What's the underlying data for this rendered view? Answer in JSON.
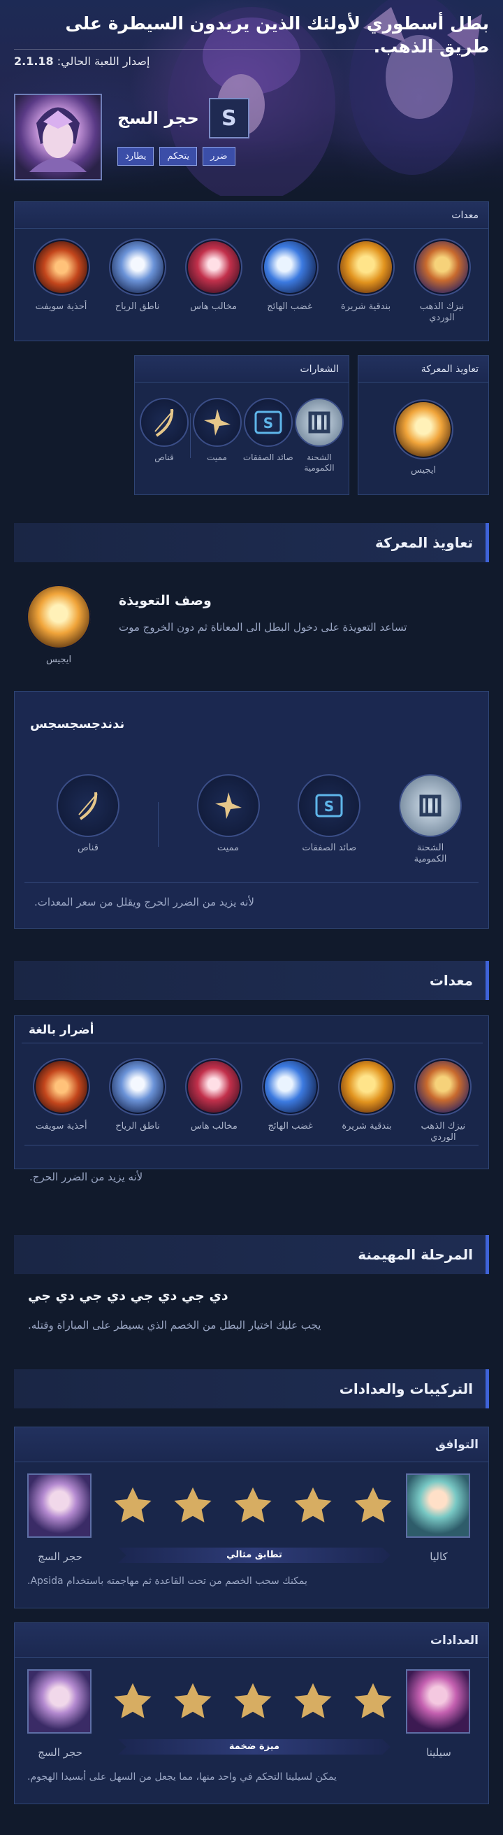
{
  "hero": {
    "title": "بطل أسطوري لأولئك الذين يريدون السيطرة على طريق الذهب.",
    "version_label": "إصدار اللعبة الحالي:",
    "version_value": "2.1.18",
    "class_icon": "S",
    "hero_name": "حجر السج",
    "tags": [
      "يطارد",
      "يتحكم",
      "ضرر"
    ]
  },
  "equipment_panel": {
    "title": "معدات",
    "items": [
      {
        "label": "نيزك الذهب الوردي",
        "icon": "pink-gold-meteor-icon"
      },
      {
        "label": "بندقية شريرة",
        "icon": "sinister-gun-icon"
      },
      {
        "label": "غضب الهائج",
        "icon": "berserker-rage-icon"
      },
      {
        "label": "مخالب هاس",
        "icon": "haas-claws-icon"
      },
      {
        "label": "ناطق الرياح",
        "icon": "windtalker-icon"
      },
      {
        "label": "أحذية سويفت",
        "icon": "swift-boots-icon"
      }
    ]
  },
  "emblems_panel": {
    "title": "الشعارات",
    "items": [
      {
        "label": "الشحنة الكمومية",
        "icon": "quantum-charge-icon"
      },
      {
        "label": "صائد الصفقات",
        "icon": "bargain-hunter-icon"
      },
      {
        "label": "مميت",
        "icon": "lethal-icon"
      },
      {
        "label": "قناص",
        "icon": "marksman-icon"
      }
    ]
  },
  "battle_spell_panel": {
    "title": "تعاويذ المعركة",
    "spell_label": "ايجيس"
  },
  "battle_spells_section": {
    "heading": "تعاويذ المعركة",
    "spell_name": "ايجيس",
    "desc_title": "وصف التعويذة",
    "desc_text": "تساعد التعويذة على دخول البطل الى المعاناة ثم دون الخروج موت"
  },
  "emblem_detail": {
    "title": "ندندجسجسجس",
    "items": [
      {
        "label": "الشحنة الكمومية"
      },
      {
        "label": "صائد الصفقات"
      },
      {
        "label": "مميت"
      },
      {
        "label": "قناص"
      }
    ],
    "note": "لأنه يزيد من الضرر الحرج ويقلل من سعر المعدات."
  },
  "equipment_section": {
    "heading": "معدات",
    "subtitle": "أضرار بالغة",
    "items": [
      {
        "label": "نيزك الذهب الوردي"
      },
      {
        "label": "بندقية شريرة"
      },
      {
        "label": "غضب الهائج"
      },
      {
        "label": "مخالب هاس"
      },
      {
        "label": "ناطق الرياح"
      },
      {
        "label": "أحذية سويفت"
      }
    ],
    "note": "لأنه يزيد من الضرر الحرج."
  },
  "dominant_phase": {
    "heading": "المرحلة المهيمنة",
    "title": "دي جي دي جي دي جي دي جي",
    "text": "يجب عليك اختيار البطل من الخصم الذي يسيطر على المباراة وقتله."
  },
  "combos_section": {
    "heading": "التركيبات والعدادات"
  },
  "synergy": {
    "title": "التوافق",
    "left_hero": "حجر السج",
    "right_hero": "كاليا",
    "stars": 5,
    "bar_label": "تطابق مثالي",
    "note": "يمكنك سحب الخصم من تحت القاعدة ثم مهاجمته باستخدام Apsida."
  },
  "counters": {
    "title": "العدادات",
    "left_hero": "حجر السج",
    "right_hero": "سيلينا",
    "stars": 5,
    "bar_label": "ميزة ضخمة",
    "note": "يمكن لسيلينا التحكم في واحد منها، مما يجعل من السهل على أبسيدا الهجوم."
  },
  "colors": {
    "accent": "#3f63d8",
    "panel": "#19264a",
    "background": "#111a2c",
    "star": "#d7ad62"
  }
}
